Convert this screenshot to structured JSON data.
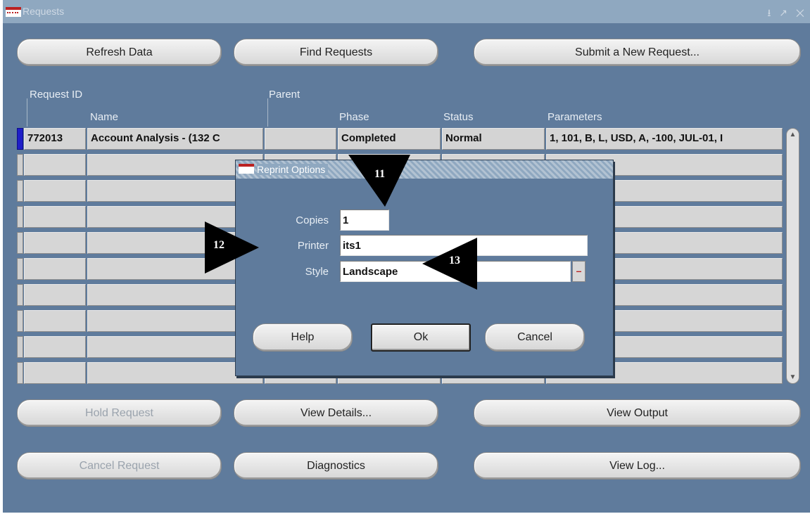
{
  "window": {
    "title": "Requests",
    "controls": "⭳ ↗ ✕"
  },
  "buttons": {
    "refresh": "Refresh Data",
    "find": "Find Requests",
    "submit": "Submit a New Request...",
    "hold": "Hold Request",
    "view_details": "View Details...",
    "view_output": "View Output",
    "cancel_request": "Cancel Request",
    "diagnostics": "Diagnostics",
    "view_log": "View Log..."
  },
  "columns": {
    "request_id": "Request ID",
    "name": "Name",
    "parent": "Parent",
    "phase": "Phase",
    "status": "Status",
    "parameters": "Parameters"
  },
  "rows": [
    {
      "request_id": "772013",
      "name": "Account Analysis - (132 C",
      "parent": "",
      "phase": "Completed",
      "status": "Normal",
      "parameters": "1, 101, B, L, USD, A, -100, JUL-01, I"
    }
  ],
  "dialog": {
    "title": "Reprint Options",
    "copies_label": "Copies",
    "copies_value": "1",
    "printer_label": "Printer",
    "printer_value": "its1",
    "style_label": "Style",
    "style_value": "Landscape",
    "lov_glyph": "–",
    "help": "Help",
    "ok": "Ok",
    "cancel": "Cancel"
  },
  "callouts": {
    "c11": "11",
    "c12": "12",
    "c13": "13"
  }
}
